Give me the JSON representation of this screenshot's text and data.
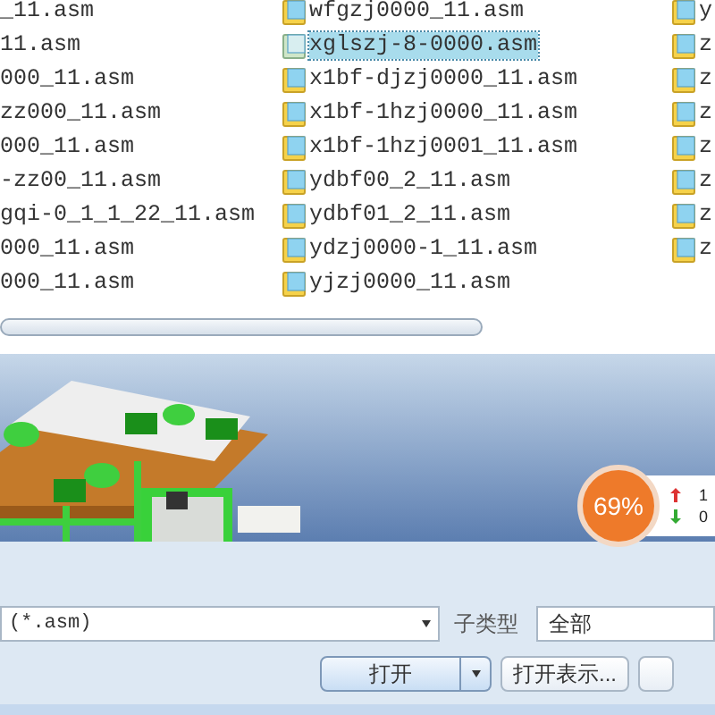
{
  "file_list": {
    "columns": [
      {
        "items": [
          {
            "name": "_11.asm",
            "selected": false
          },
          {
            "name": "11.asm",
            "selected": false
          },
          {
            "name": "000_11.asm",
            "selected": false
          },
          {
            "name": "zz000_11.asm",
            "selected": false
          },
          {
            "name": "000_11.asm",
            "selected": false
          },
          {
            "name": "-zz00_11.asm",
            "selected": false
          },
          {
            "name": "gqi-0_1_1_22_11.asm",
            "selected": false
          },
          {
            "name": "000_11.asm",
            "selected": false
          },
          {
            "name": "000_11.asm",
            "selected": false
          }
        ]
      },
      {
        "items": [
          {
            "name": "wfgzj0000_11.asm",
            "selected": false
          },
          {
            "name": "xglszj-8-0000.asm",
            "selected": true
          },
          {
            "name": "x1bf-djzj0000_11.asm",
            "selected": false
          },
          {
            "name": "x1bf-1hzj0000_11.asm",
            "selected": false
          },
          {
            "name": "x1bf-1hzj0001_11.asm",
            "selected": false
          },
          {
            "name": "ydbf00_2_11.asm",
            "selected": false
          },
          {
            "name": "ydbf01_2_11.asm",
            "selected": false
          },
          {
            "name": "ydzj0000-1_11.asm",
            "selected": false
          },
          {
            "name": "yjzj0000_11.asm",
            "selected": false
          }
        ]
      },
      {
        "items": [
          {
            "name": "y",
            "selected": false
          },
          {
            "name": "z",
            "selected": false
          },
          {
            "name": "z",
            "selected": false
          },
          {
            "name": "z",
            "selected": false
          },
          {
            "name": "z",
            "selected": false
          },
          {
            "name": "z",
            "selected": false
          },
          {
            "name": "z",
            "selected": false
          },
          {
            "name": "z",
            "selected": false
          }
        ]
      }
    ]
  },
  "speed_widget": {
    "percent": "69%",
    "up": "1",
    "down": "0"
  },
  "filter": {
    "type_value": "(*.asm)",
    "subtype_label": "子类型",
    "subtype_value": "全部"
  },
  "buttons": [
    {
      "label": "打开",
      "kind": "split"
    },
    {
      "label": "打开表示...",
      "kind": "plain"
    },
    {
      "kind": "plain"
    }
  ]
}
